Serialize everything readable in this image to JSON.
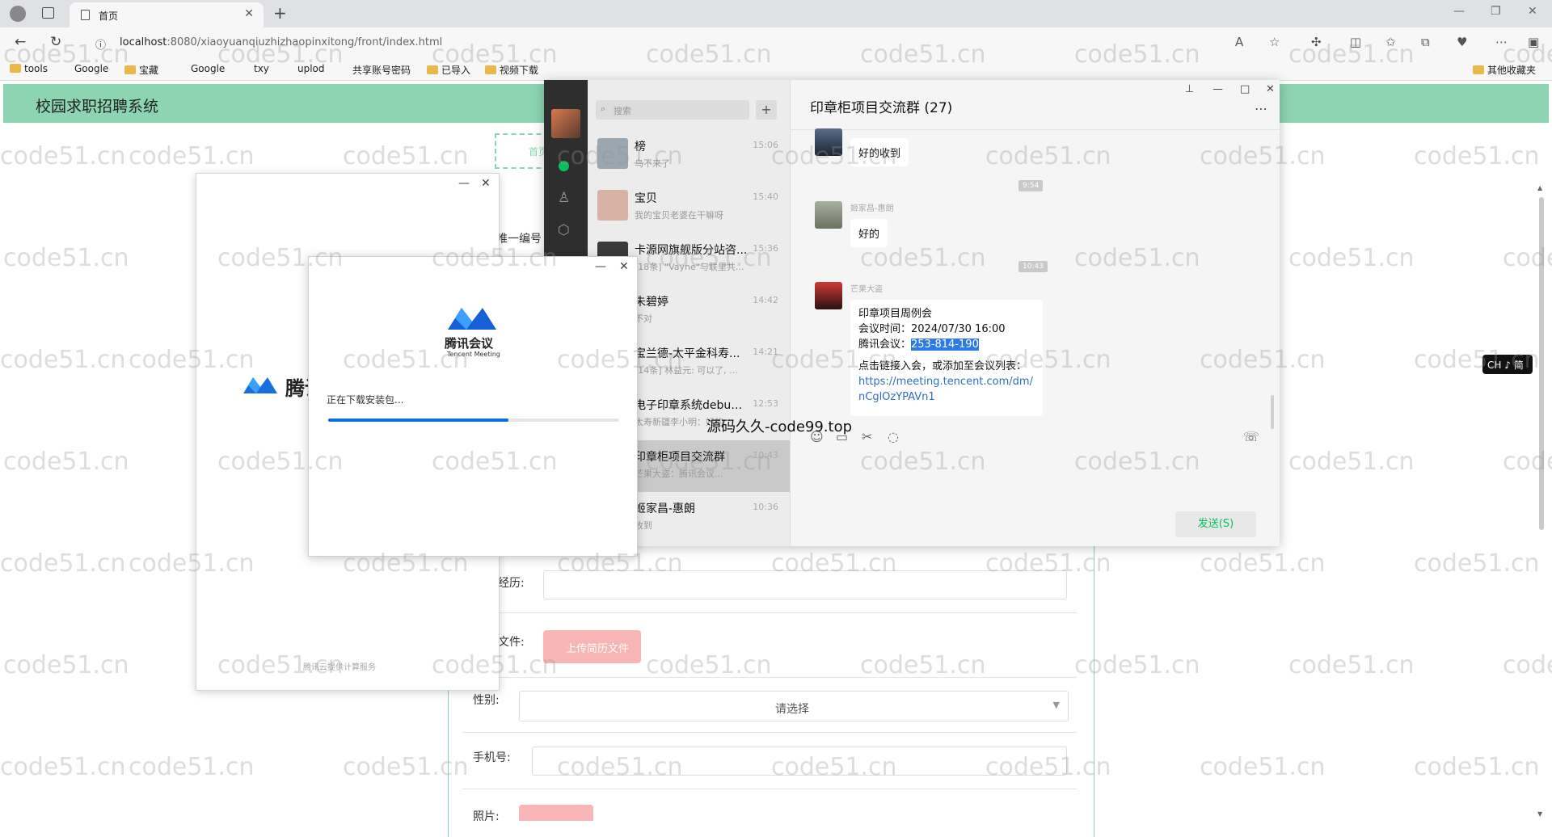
{
  "browser": {
    "tab_title": "首页",
    "url_host": "localhost",
    "url_path": ":8080/xiaoyuanqiuzhizhaopinxitong/front/index.html",
    "bookmarks": [
      "tools",
      "Google",
      "宝藏",
      "Google",
      "txy",
      "uplod",
      "共享账号密码",
      "已导入",
      "视频下载"
    ],
    "bookmarks_right": "其他收藏夹"
  },
  "page": {
    "site_title": "校园求职招聘系统",
    "nav_home": "首页",
    "labels": {
      "id": "唯一编号",
      "resume": "经历:",
      "resume_file": "文件:",
      "gender": "性别:",
      "phone": "手机号:",
      "photo": "照片:"
    },
    "upload_button": "上传简历文件",
    "gender_placeholder": "请选择"
  },
  "tencent": {
    "back_logo_text": "腾讯",
    "back_footer": "腾讯云提供计算服务",
    "brand": "腾讯会议",
    "brand_en": "Tencent Meeting",
    "status": "正在下载安装包...",
    "progress": 0.62
  },
  "wechat": {
    "search_placeholder": "搜索",
    "chats": [
      {
        "name": "榜",
        "time": "15:06",
        "preview": "乌不来了"
      },
      {
        "name": "宝贝",
        "time": "15:40",
        "preview": "我的宝贝老婆在干嘛呀"
      },
      {
        "name": "卡源网旗舰版分站咨...",
        "time": "15:36",
        "preview": "[18条] \"Vayne\"与联里共..."
      },
      {
        "name": "朱碧婷",
        "time": "14:42",
        "preview": "不对"
      },
      {
        "name": "宝兰德-太平金科寿...",
        "time": "14:21",
        "preview": "[14条] 林益元: 可以了, ..."
      },
      {
        "name": "电子印章系统debug...",
        "time": "12:53",
        "preview": "太寿新疆李小明：好的"
      },
      {
        "name": "印章柜项目交流群",
        "time": "10:43",
        "preview": "芒果大盗：腾讯会议..."
      },
      {
        "name": "姬家昌-惠朗",
        "time": "10:36",
        "preview": "收到"
      }
    ],
    "chat_title": "印章柜项目交流群 (27)",
    "messages": {
      "m1_text": "好的收到",
      "m1_time": "9:54",
      "m2_sender": "姬家昌-惠朗",
      "m2_text": "好的",
      "m2_time": "10:43",
      "m3_sender": "芒果大盗",
      "m3_line1": "印章项目周例会",
      "m3_line2": "会议时间：2024/07/30 16:00",
      "m3_line3_label": "腾讯会议：",
      "m3_line3_code": "253-814-190",
      "m3_line4": "点击链接入会，或添加至会议列表：",
      "m3_link1": "https://meeting.tencent.com/dm/",
      "m3_link2": "nCglOzYPAVn1"
    },
    "send_button": "发送(S)"
  },
  "overlay_text": "源码久久-code99.top",
  "ime": "CH ♪ 简",
  "watermark": "code51.cn"
}
